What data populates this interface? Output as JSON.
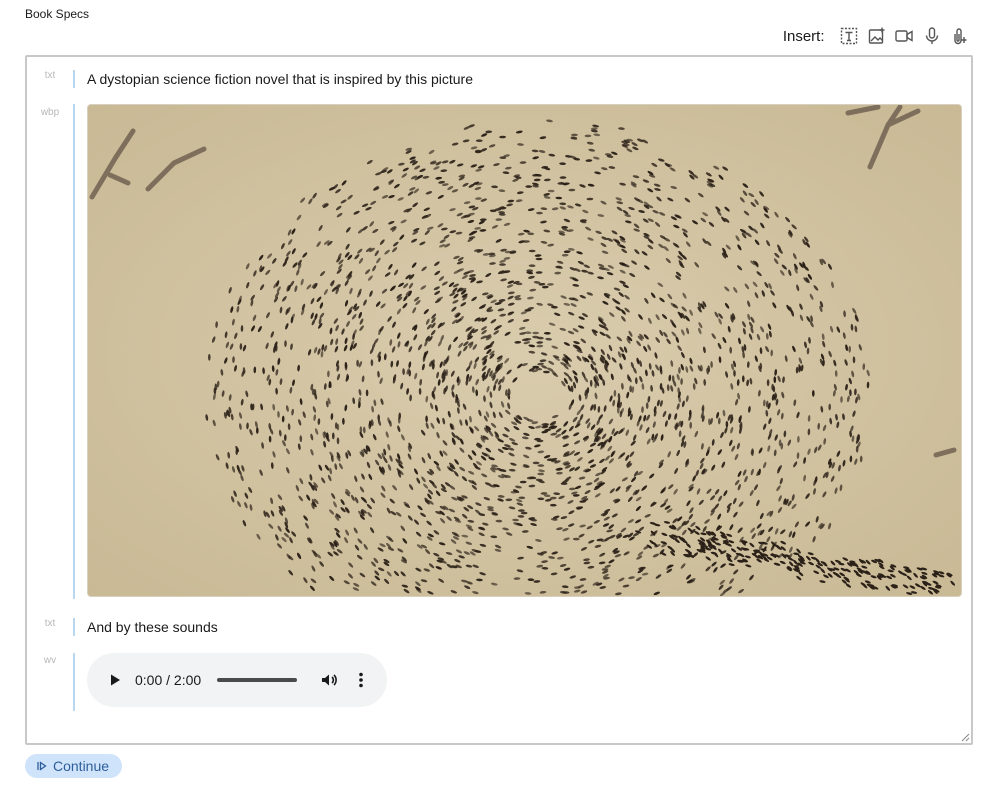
{
  "section_label": "Book Specs",
  "insert": {
    "label": "Insert:",
    "buttons": [
      {
        "icon": "text-block-icon"
      },
      {
        "icon": "image-add-icon"
      },
      {
        "icon": "video-icon"
      },
      {
        "icon": "microphone-icon"
      },
      {
        "icon": "attachment-icon"
      }
    ]
  },
  "blocks": [
    {
      "type_tag": "txt",
      "text": "A dystopian science fiction novel that is inspired by this picture"
    },
    {
      "type_tag": "wbp",
      "image_description": "ant-mill-photo"
    },
    {
      "type_tag": "txt",
      "text": "And by these sounds"
    },
    {
      "type_tag": "wv",
      "audio": {
        "time": "0:00 / 2:00",
        "progress": 0
      }
    }
  ],
  "continue_button": {
    "label": "Continue"
  },
  "colors": {
    "accent_bar": "#b9d8f0",
    "continue_bg": "#cfe3fb",
    "continue_text": "#2e5f9a",
    "sand": "#d2c4a3",
    "ant": "#2b2118"
  }
}
